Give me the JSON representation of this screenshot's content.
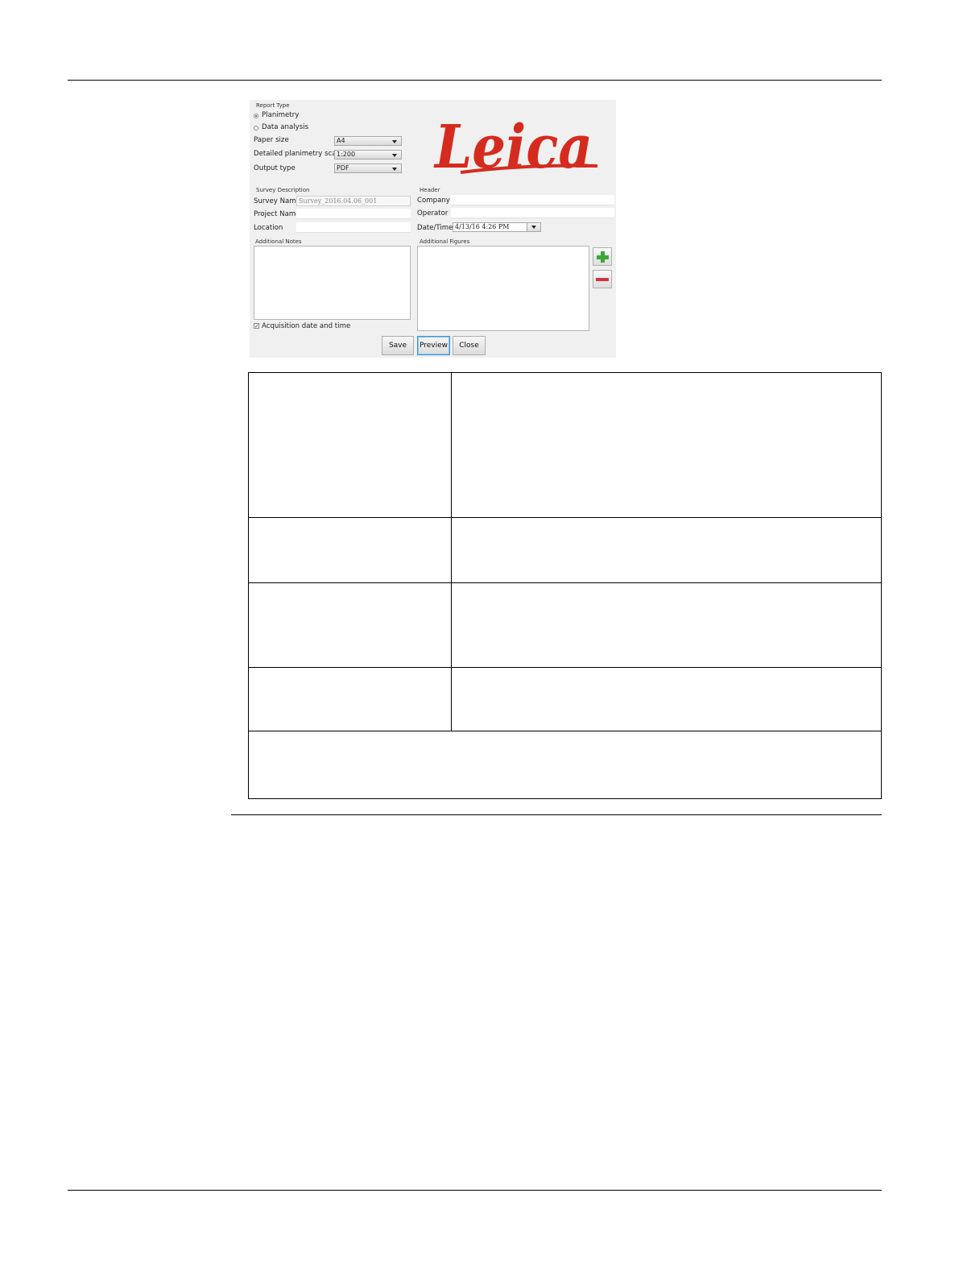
{
  "dialog": {
    "report_type": {
      "group_label": "Report Type",
      "options": [
        "Planimetry",
        "Data analysis"
      ],
      "selected": "Planimetry"
    },
    "paper_size": {
      "label": "Paper size",
      "value": "A4"
    },
    "planimetry_scale": {
      "label": "Detailed planimetry scale",
      "value": "1:200"
    },
    "output_type": {
      "label": "Output type",
      "value": "PDF"
    },
    "logo": {
      "text": "Leica",
      "color": "#d52b1e"
    },
    "survey_description": {
      "group_label": "Survey Description",
      "survey_name_label": "Survey Name",
      "survey_name_value": "Survey_2016.04.06_001",
      "project_name_label": "Project Name",
      "location_label": "Location"
    },
    "header": {
      "group_label": "Header",
      "company_label": "Company",
      "operator_label": "Operator",
      "datetime_label": "Date/Time",
      "datetime_value": "4/13/16 4:26 PM"
    },
    "additional_notes_label": "Additional Notes",
    "additional_figures_label": "Additional Figures",
    "acquisition_label": "Acquisition date and time",
    "acquisition_checked": "✓",
    "buttons": {
      "save": "Save",
      "preview": "Preview",
      "close": "Close"
    },
    "icons": {
      "add": "plus-icon",
      "remove": "minus-icon"
    },
    "colors": {
      "add": "#3ea63a",
      "remove": "#d5323f",
      "focus": "#3c93d6"
    }
  }
}
